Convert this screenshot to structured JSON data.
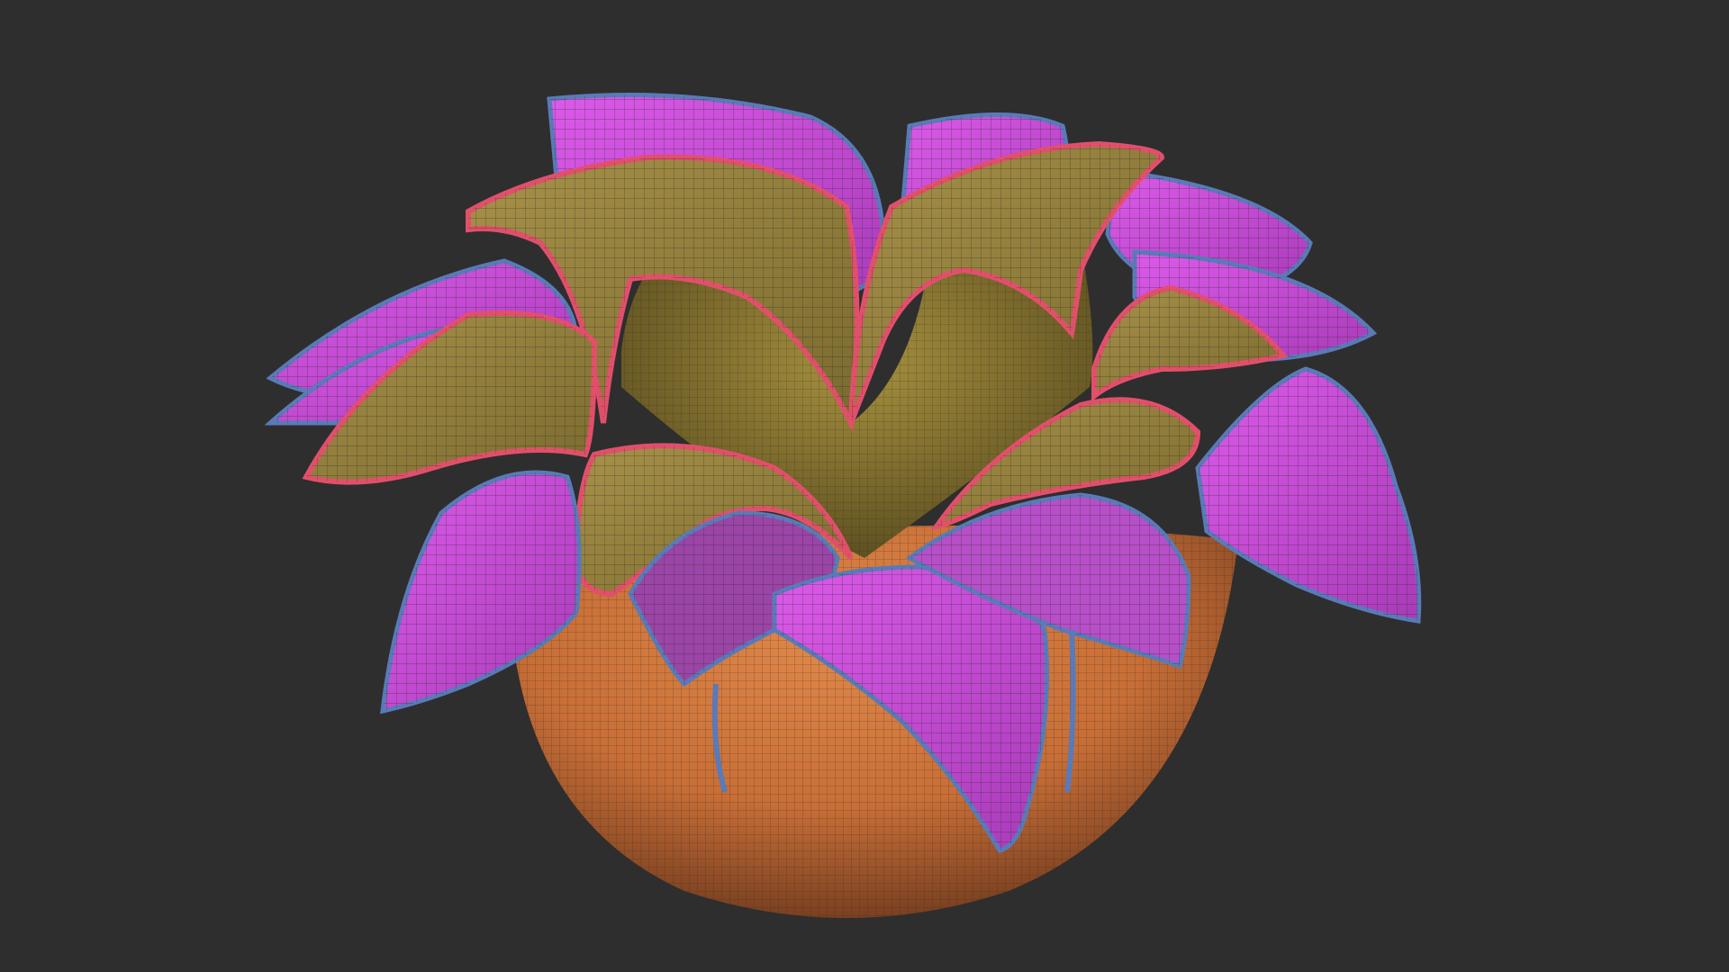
{
  "viewport": {
    "background": "#2e2e2e"
  },
  "model": {
    "subject": "flower-in-pot",
    "colors": {
      "pot": "#d67a3e",
      "pot_shadow": "#8a4a24",
      "outer_petals": "#d24fe0",
      "outer_petals_shade": "#9a3aa8",
      "inner_petals": "#a08a3e",
      "inner_petals_shade": "#6e5d26",
      "petal_edge_inner": "#e0506a",
      "petal_edge_outer": "#5a7ab8",
      "center": "#8a7a30",
      "wire": "#2a2a2a"
    }
  }
}
